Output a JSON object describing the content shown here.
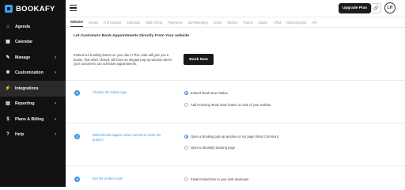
{
  "brand": {
    "name": "BOOKAFY"
  },
  "sidebar": {
    "items": [
      {
        "label": "Agenda",
        "icon": "home-icon",
        "chevron": false,
        "active": false
      },
      {
        "label": "Calendar",
        "icon": "calendar-icon",
        "chevron": false,
        "active": false
      },
      {
        "label": "Manage",
        "icon": "edit-icon",
        "chevron": true,
        "active": false
      },
      {
        "label": "Customization",
        "icon": "palette-icon",
        "chevron": true,
        "active": false
      },
      {
        "label": "Integrations",
        "icon": "bolt-icon",
        "chevron": false,
        "active": true
      },
      {
        "label": "Reporting",
        "icon": "chart-icon",
        "chevron": true,
        "active": false
      },
      {
        "label": "Plans & Billing",
        "icon": "dollar-icon",
        "chevron": true,
        "active": false
      },
      {
        "label": "Help",
        "icon": "help-icon",
        "chevron": true,
        "active": false
      }
    ]
  },
  "header": {
    "upgrade_label": "Upgrade Plan",
    "avatar_initials": "LH"
  },
  "tabs": [
    "Website",
    "Hooks",
    "Full Contact",
    "Calendar",
    "Mail Chimp",
    "Payments",
    "GoToMeeting",
    "Zoom",
    "Webex",
    "Teams",
    "Zapier",
    "CRM",
    "Data injection",
    "API"
  ],
  "intro": {
    "title": "Let Customers Book Appointments Directly From Your website",
    "description": "Embed our booking button on your site in This code will give you a button, that when clicked, will have an elegant pop-up window where your customers can schedule appointments.",
    "button_label": "Book Now"
  },
  "steps": [
    {
      "number": "1",
      "question": "Choose the button type",
      "options": [
        {
          "label": "Embed 'Book Now' button",
          "checked": true
        },
        {
          "label": "Add Hovering 'Book Now' button on side of your website",
          "checked": false
        }
      ]
    },
    {
      "number": "2",
      "question": "What should happen when someone clicks the button?",
      "options": [
        {
          "label": "Open a Booking pop-up window on my page (Most Common)",
          "checked": true
        },
        {
          "label": "Open to Bookafy booking page",
          "checked": false
        }
      ]
    },
    {
      "number": "3",
      "question": "Get the embed code",
      "options": [
        {
          "label": "Email instructions to your web developer",
          "checked": false
        }
      ]
    }
  ],
  "colors": {
    "accent": "#3f95e4",
    "sidebar_bg": "#111111",
    "button_bg": "#1a1a1a"
  }
}
